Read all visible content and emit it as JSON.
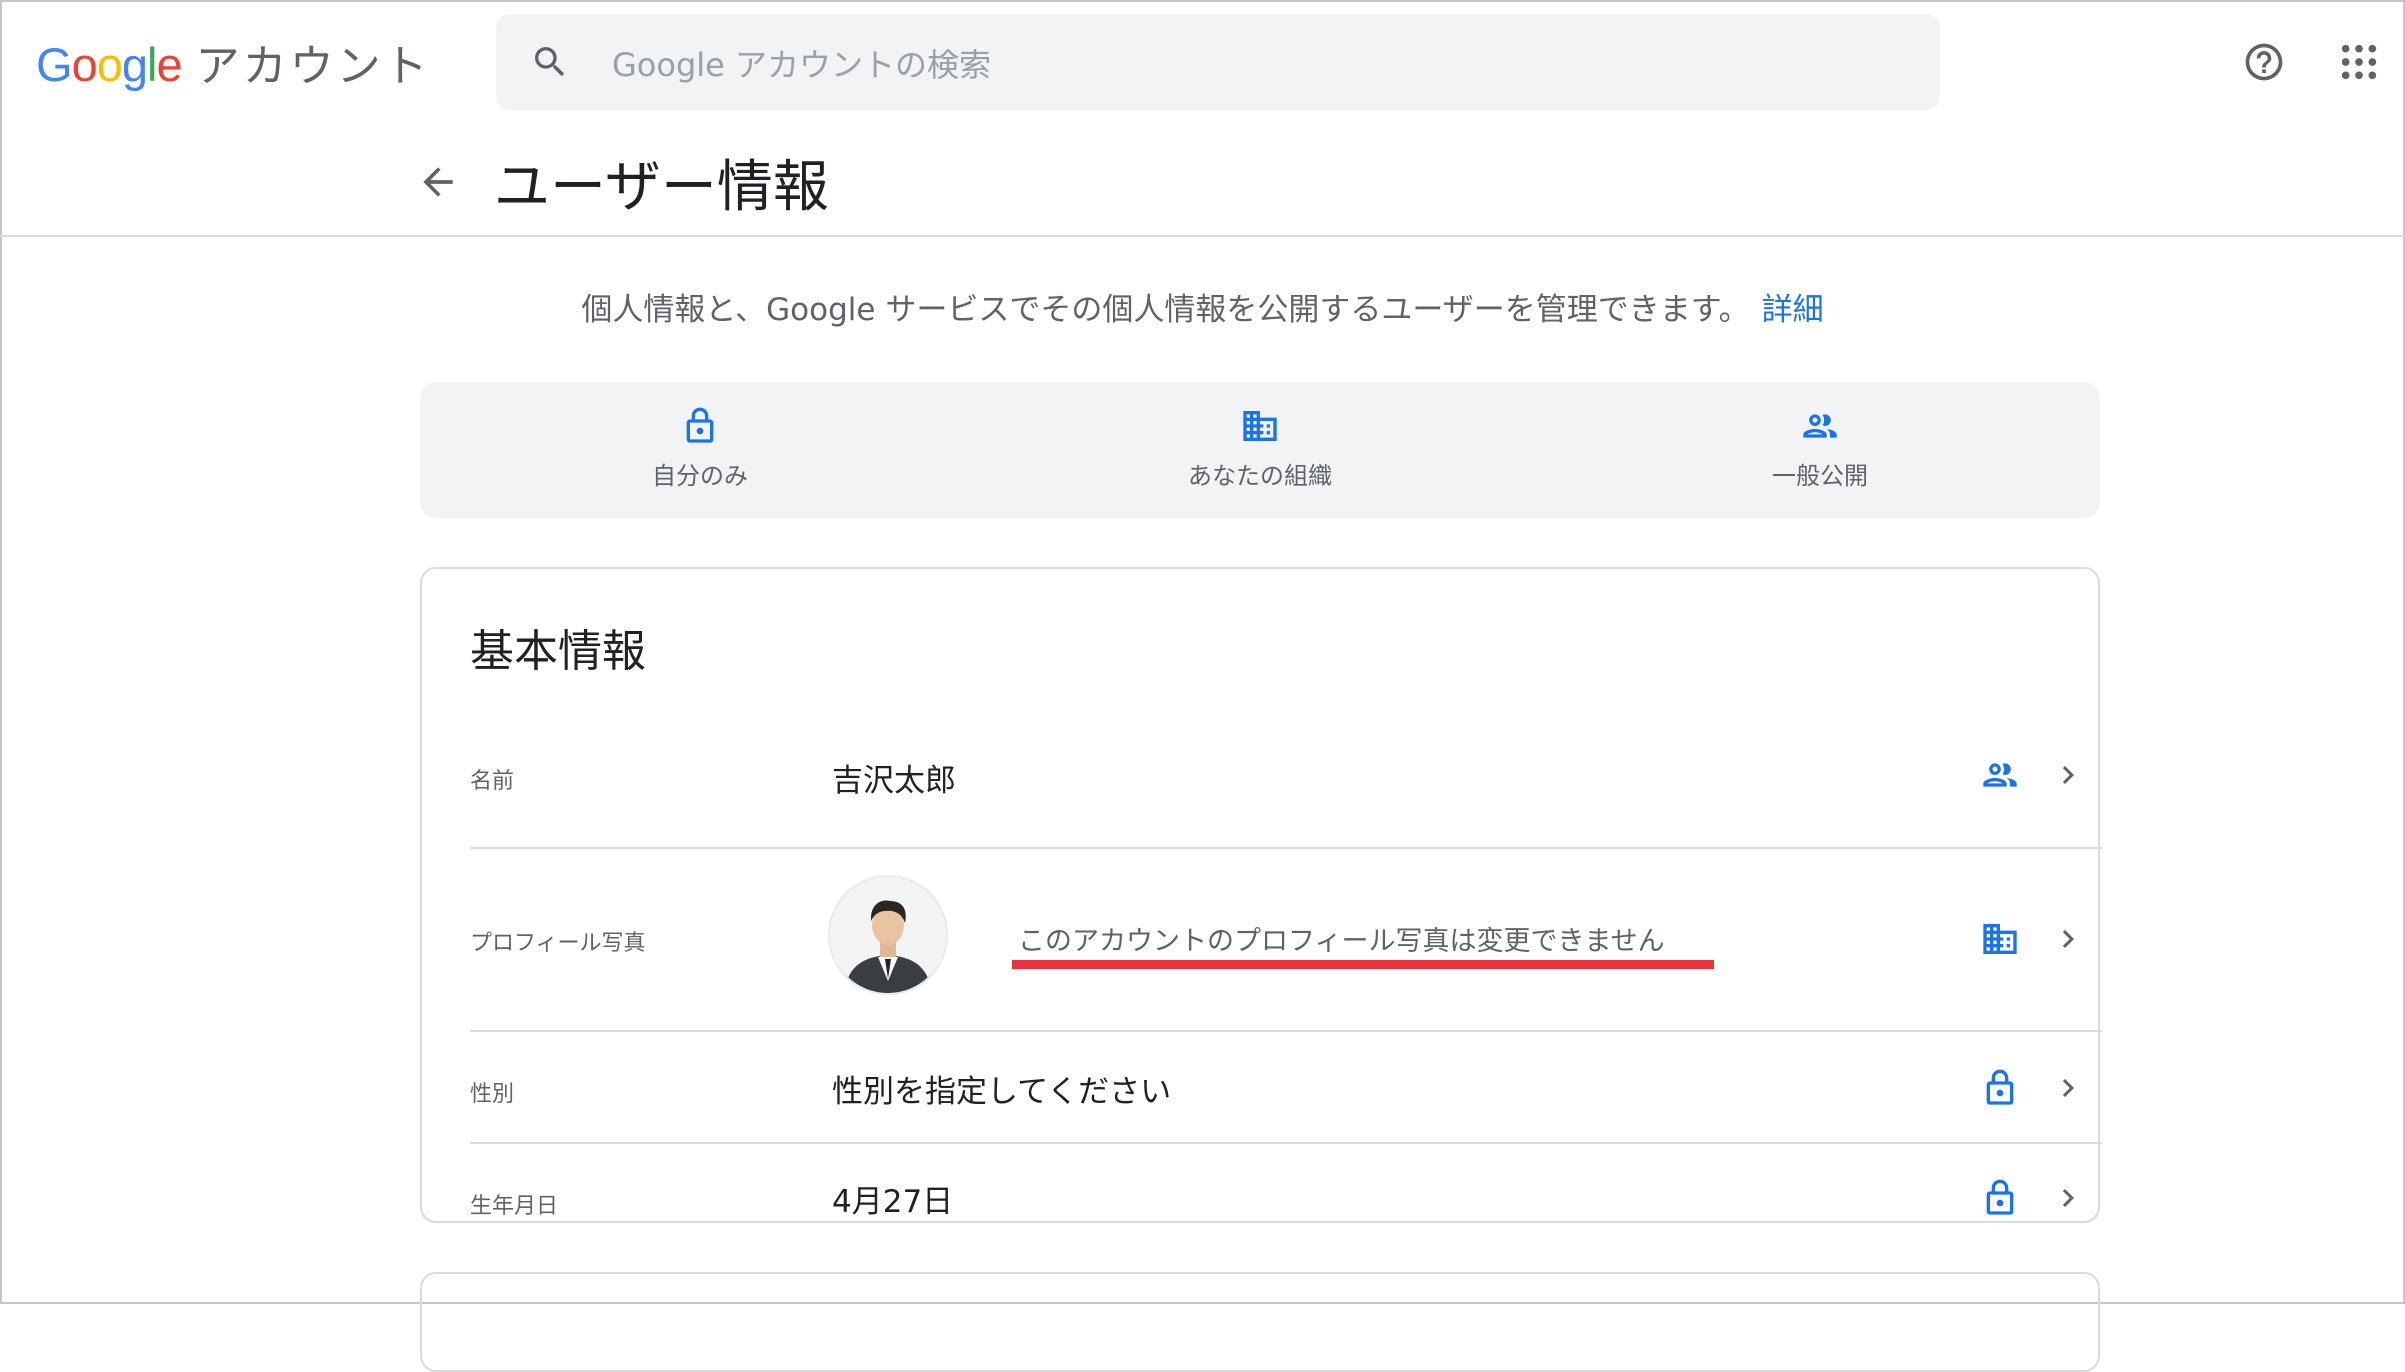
{
  "header": {
    "logo_letters": [
      {
        "ch": "G",
        "color": "#4285F4"
      },
      {
        "ch": "o",
        "color": "#EA4335"
      },
      {
        "ch": "o",
        "color": "#FBBC05"
      },
      {
        "ch": "g",
        "color": "#4285F4"
      },
      {
        "ch": "l",
        "color": "#34A853"
      },
      {
        "ch": "e",
        "color": "#EA4335"
      }
    ],
    "product_name": "アカウント",
    "search_placeholder": "Google アカウントの検索",
    "search_icon": "search-icon",
    "help_icon": "help-icon",
    "apps_icon": "apps-grid-icon"
  },
  "page": {
    "title": "ユーザー情報",
    "intro_text": "個人情報と、Google サービスでその個人情報を公開するユーザーを管理できます。",
    "intro_link": "詳細"
  },
  "visibility_legend": [
    {
      "label": "自分のみ",
      "icon": "lock-icon"
    },
    {
      "label": "あなたの組織",
      "icon": "building-icon"
    },
    {
      "label": "一般公開",
      "icon": "people-icon"
    }
  ],
  "basic_info": {
    "title": "基本情報",
    "rows": [
      {
        "label": "名前",
        "value": "吉沢太郎",
        "visibility_icon": "people-icon"
      },
      {
        "label": "プロフィール写真",
        "value": "このアカウントのプロフィール写真は変更できません",
        "visibility_icon": "building-icon"
      },
      {
        "label": "性別",
        "value": "性別を指定してください",
        "visibility_icon": "lock-icon"
      },
      {
        "label": "生年月日",
        "value": "4月27日",
        "visibility_icon": "lock-icon"
      }
    ]
  },
  "colors": {
    "accent_blue": "#1a73e8",
    "highlight_red": "#e8333a",
    "surface_gray": "#f1f3f4",
    "divider": "#dadce0"
  }
}
